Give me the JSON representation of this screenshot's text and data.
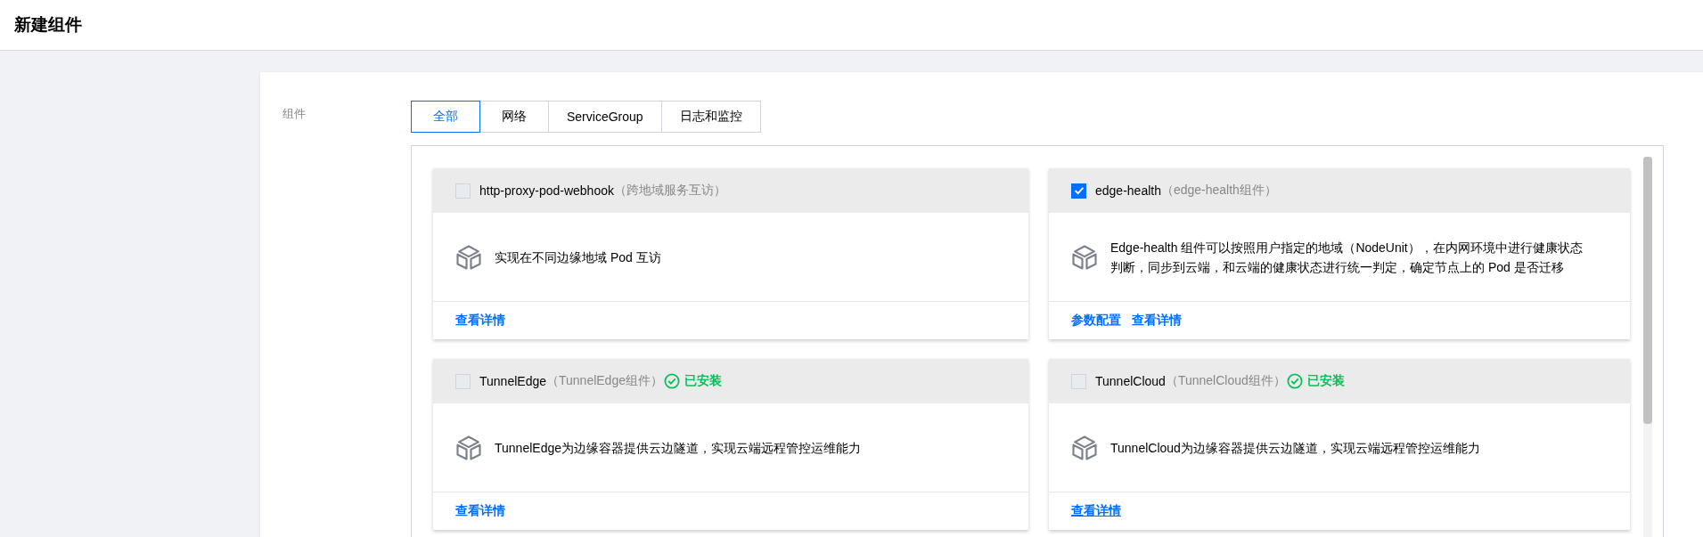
{
  "page_title": "新建组件",
  "form": {
    "label": "组件",
    "tabs": [
      {
        "label": "全部",
        "selected": true
      },
      {
        "label": "网络",
        "selected": false
      },
      {
        "label": "ServiceGroup",
        "selected": false
      },
      {
        "label": "日志和监控",
        "selected": false
      }
    ],
    "components": [
      {
        "name": "http-proxy-pod-webhook",
        "subtitle": "（跨地域服务互访）",
        "checked": false,
        "installed": false,
        "description": "实现在不同边缘地域 Pod 互访",
        "links": [
          {
            "label": "查看详情",
            "hovered": false
          }
        ]
      },
      {
        "name": "edge-health",
        "subtitle": "（edge-health组件）",
        "checked": true,
        "installed": false,
        "description": "Edge-health 组件可以按照用户指定的地域（NodeUnit），在内网环境中进行健康状态判断，同步到云端，和云端的健康状态进行统一判定，确定节点上的 Pod 是否迁移",
        "links": [
          {
            "label": "参数配置",
            "hovered": false
          },
          {
            "label": "查看详情",
            "hovered": false
          }
        ]
      },
      {
        "name": "TunnelEdge",
        "subtitle": "（TunnelEdge组件）",
        "checked": false,
        "installed": true,
        "installed_label": "已安装",
        "description": "TunnelEdge为边缘容器提供云边隧道，实现云端远程管控运维能力",
        "links": [
          {
            "label": "查看详情",
            "hovered": false
          }
        ]
      },
      {
        "name": "TunnelCloud",
        "subtitle": "（TunnelCloud组件）",
        "checked": false,
        "installed": true,
        "installed_label": "已安装",
        "description": "TunnelCloud为边缘容器提供云边隧道，实现云端远程管控运维能力",
        "links": [
          {
            "label": "查看详情",
            "hovered": true
          }
        ]
      }
    ]
  }
}
